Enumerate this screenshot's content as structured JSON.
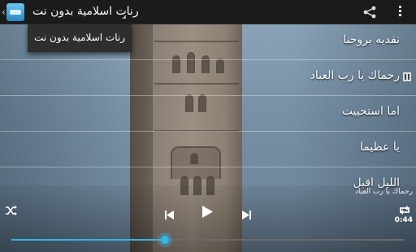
{
  "header": {
    "title": "رنات اسلامية بدون نت",
    "back_icon": "chevron-left-icon",
    "app_icon": "app-logo-icon",
    "share_icon": "share-icon",
    "overflow_icon": "overflow-menu-icon"
  },
  "dropdown": {
    "items": [
      "رنات اسلامية بدون نت"
    ]
  },
  "list": {
    "items": [
      {
        "label": "نفديه بروحنا",
        "playing": false
      },
      {
        "label": "رحماك يا رب العباد",
        "playing": true
      },
      {
        "label": "اما استحييت",
        "playing": false
      },
      {
        "label": "يا عظيما",
        "playing": false
      },
      {
        "label": "الليل اقبل",
        "playing": false
      }
    ]
  },
  "player": {
    "now_playing": "رحماك يا رب العباد",
    "time": "0:44",
    "progress": 0.39,
    "accent": "#33b5e5"
  }
}
